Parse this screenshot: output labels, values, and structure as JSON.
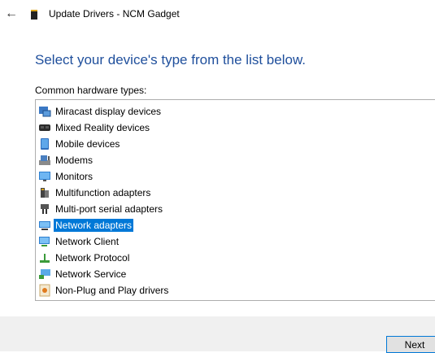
{
  "window": {
    "title": "Update Drivers - NCM Gadget"
  },
  "main": {
    "heading": "Select your device's type from the list below.",
    "list_label": "Common hardware types:",
    "items": [
      {
        "label": "Miracast display devices",
        "icon": "miracast-icon"
      },
      {
        "label": "Mixed Reality devices",
        "icon": "headset-icon"
      },
      {
        "label": "Mobile devices",
        "icon": "mobile-device-icon"
      },
      {
        "label": "Modems",
        "icon": "modem-icon"
      },
      {
        "label": "Monitors",
        "icon": "monitor-icon"
      },
      {
        "label": "Multifunction adapters",
        "icon": "multifunction-adapter-icon"
      },
      {
        "label": "Multi-port serial adapters",
        "icon": "serial-port-icon"
      },
      {
        "label": "Network adapters",
        "icon": "network-adapter-icon",
        "selected": true
      },
      {
        "label": "Network Client",
        "icon": "network-client-icon"
      },
      {
        "label": "Network Protocol",
        "icon": "network-protocol-icon"
      },
      {
        "label": "Network Service",
        "icon": "network-service-icon"
      },
      {
        "label": "Non-Plug and Play drivers",
        "icon": "non-pnp-driver-icon"
      },
      {
        "label": "",
        "icon": "partially-hidden-icon"
      }
    ]
  },
  "footer": {
    "next_label": "Next"
  },
  "colors": {
    "accent": "#0078d7",
    "heading": "#1f4f9c",
    "footer_bg": "#f0f0f0"
  }
}
